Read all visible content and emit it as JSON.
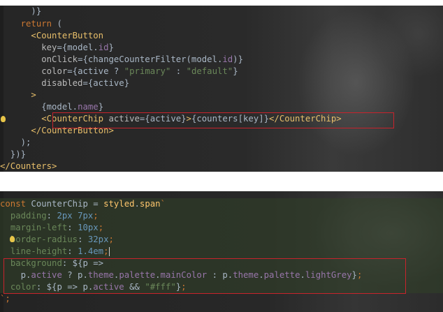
{
  "top_panel": {
    "lines": [
      "",
      "    return (",
      "      <CounterButton",
      "        key={model.id}",
      "        onClick={changeCounterFilter(model.id)}",
      "        color={active ? \"primary\" : \"default\"}",
      "        disabled={active}",
      "      >",
      "        {model.name}",
      "        <CounterChip active={active}>{counters[key]}</CounterChip>",
      "      </CounterButton>",
      "    );",
      "  })}",
      "</Counters>"
    ],
    "highlighted_line": "        <CounterChip active={active}>{counters[key]}</CounterChip>"
  },
  "bottom_panel": {
    "lines": [
      "const CounterChip = styled.span`",
      "  padding: 2px 7px;",
      "  margin-left: 10px;",
      "  border-radius: 32px;",
      "  line-height: 1.4em;",
      "  background: ${p =>",
      "    p.active ? p.theme.palette.mainColor : p.theme.palette.lightGrey};",
      "  color: ${p => p.active && \"#fff\"};",
      "`;"
    ]
  },
  "colors": {
    "keyword": "#cc7832",
    "jsx_tag": "#e8bf6a",
    "string": "#6a8759",
    "property": "#9876aa",
    "number": "#6897bb",
    "default_text": "#a9b7c6",
    "highlight_box": "#c8232c"
  }
}
